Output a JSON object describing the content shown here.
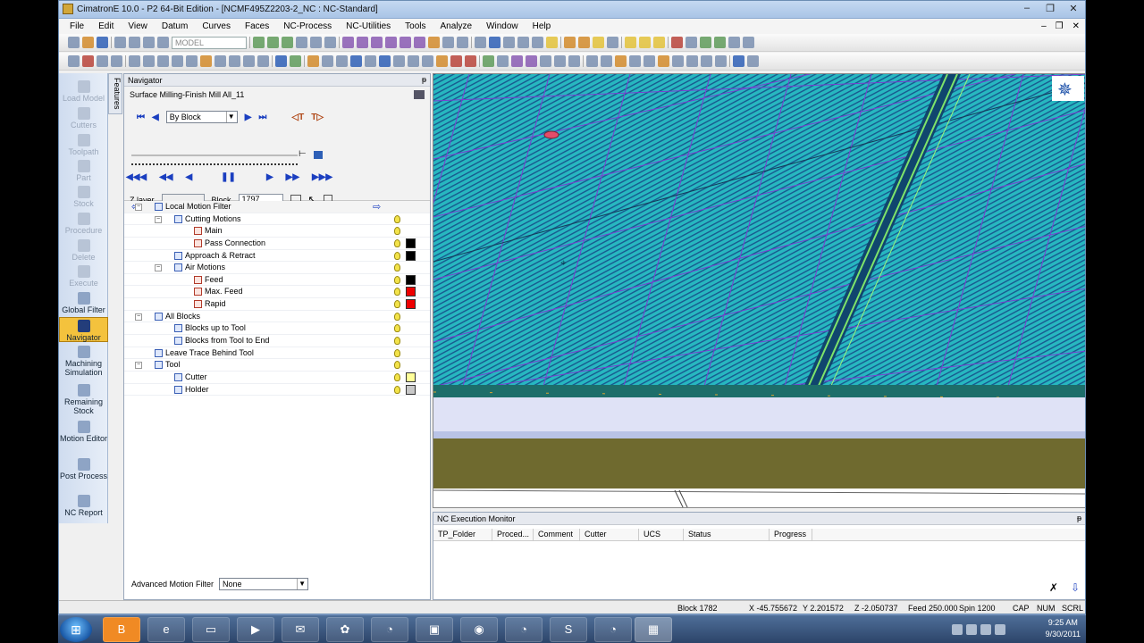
{
  "window": {
    "title": "CimatronE 10.0 - P2 64-Bit Edition - [NCMF495Z2203-2_NC : NC-Standard]",
    "min": "–",
    "max": "❐",
    "close": "✕"
  },
  "menu": [
    "File",
    "Edit",
    "View",
    "Datum",
    "Curves",
    "Faces",
    "NC-Process",
    "NC-Utilities",
    "Tools",
    "Analyze",
    "Window",
    "Help"
  ],
  "mdi_controls": {
    "min": "–",
    "max": "❐",
    "close": "✕"
  },
  "toolbar": {
    "model_combo": "MODEL"
  },
  "sidebar": {
    "features_tab": "Features",
    "items": [
      {
        "label": "Load Model",
        "enabled": false
      },
      {
        "label": "Cutters",
        "enabled": false
      },
      {
        "label": "Toolpath",
        "enabled": false
      },
      {
        "label": "Part",
        "enabled": false
      },
      {
        "label": "Stock",
        "enabled": false
      },
      {
        "label": "Procedure",
        "enabled": false
      },
      {
        "label": "Delete",
        "enabled": false
      },
      {
        "label": "Execute",
        "enabled": false
      },
      {
        "label": "Global Filter",
        "enabled": true
      },
      {
        "label": "Navigator",
        "enabled": true,
        "active": true
      },
      {
        "label": "Machining Simulation",
        "enabled": true
      },
      {
        "label": "Remaining Stock",
        "enabled": true
      },
      {
        "label": "Motion Editor",
        "enabled": true
      },
      {
        "label": "Post Process",
        "enabled": true
      },
      {
        "label": "NC Report",
        "enabled": true
      }
    ]
  },
  "navigator": {
    "title": "Navigator",
    "pin": "ᵽ",
    "procedure": "Surface Milling-Finish Mill All_11",
    "step_mode": "By Block",
    "z_layer_label": "Z layer",
    "z_layer_value": "",
    "block_label": "Block",
    "block_value": "1797",
    "tree": [
      {
        "label": "Local Motion Filter",
        "level": 0,
        "expand": "−",
        "bulb": false
      },
      {
        "label": "Cutting Motions",
        "level": 1,
        "expand": "−",
        "bulb": true
      },
      {
        "label": "Main",
        "level": 2,
        "bulb": true
      },
      {
        "label": "Pass Connection",
        "level": 2,
        "bulb": true,
        "color": "#000000"
      },
      {
        "label": "Approach & Retract",
        "level": 1,
        "bulb": true,
        "color": "#000000"
      },
      {
        "label": "Air Motions",
        "level": 1,
        "expand": "−",
        "bulb": true
      },
      {
        "label": "Feed",
        "level": 2,
        "bulb": true,
        "color": "#000000"
      },
      {
        "label": "Max. Feed",
        "level": 2,
        "bulb": true,
        "color": "#ee0000"
      },
      {
        "label": "Rapid",
        "level": 2,
        "bulb": true,
        "color": "#ee0000"
      },
      {
        "label": "All Blocks",
        "level": 0,
        "expand": "−",
        "bulb": true
      },
      {
        "label": "Blocks up to Tool",
        "level": 1,
        "bulb": true
      },
      {
        "label": "Blocks from Tool to End",
        "level": 1,
        "bulb": true
      },
      {
        "label": "Leave Trace Behind Tool",
        "level": 0,
        "bulb": true
      },
      {
        "label": "Tool",
        "level": 0,
        "expand": "−",
        "bulb": true
      },
      {
        "label": "Cutter",
        "level": 1,
        "bulb": true,
        "color": "#ffff99"
      },
      {
        "label": "Holder",
        "level": 1,
        "bulb": true,
        "color": "#c8c8c8"
      }
    ],
    "advanced_filter_label": "Advanced Motion Filter",
    "advanced_filter_value": "None"
  },
  "monitor": {
    "title": "NC Execution Monitor",
    "columns": [
      "TP_Folder",
      "Proced...",
      "Comment",
      "Cutter",
      "UCS",
      "Status",
      "Progress"
    ]
  },
  "status": {
    "block": "Block 1782",
    "x": "X -45.755672",
    "y": "Y 2.201572",
    "z": "Z -2.050737",
    "feed": "Feed 250.000",
    "spin": "Spin 1200",
    "cap": "CAP",
    "num": "NUM",
    "scrl": "SCRL"
  },
  "taskbar": {
    "apps": [
      "start",
      "blogger",
      "ie",
      "explorer",
      "media",
      "mail",
      "flower",
      "chrome",
      "cube",
      "firefox",
      "chrome2",
      "skype",
      "chrome3",
      "cimatron"
    ],
    "time": "9:25 AM",
    "date": "9/30/2011"
  },
  "colors": {
    "viewport_bg": "#25b6bf",
    "stripe": "#17538a",
    "grid": "#7a3fd0",
    "band": "#6f6a2f"
  }
}
